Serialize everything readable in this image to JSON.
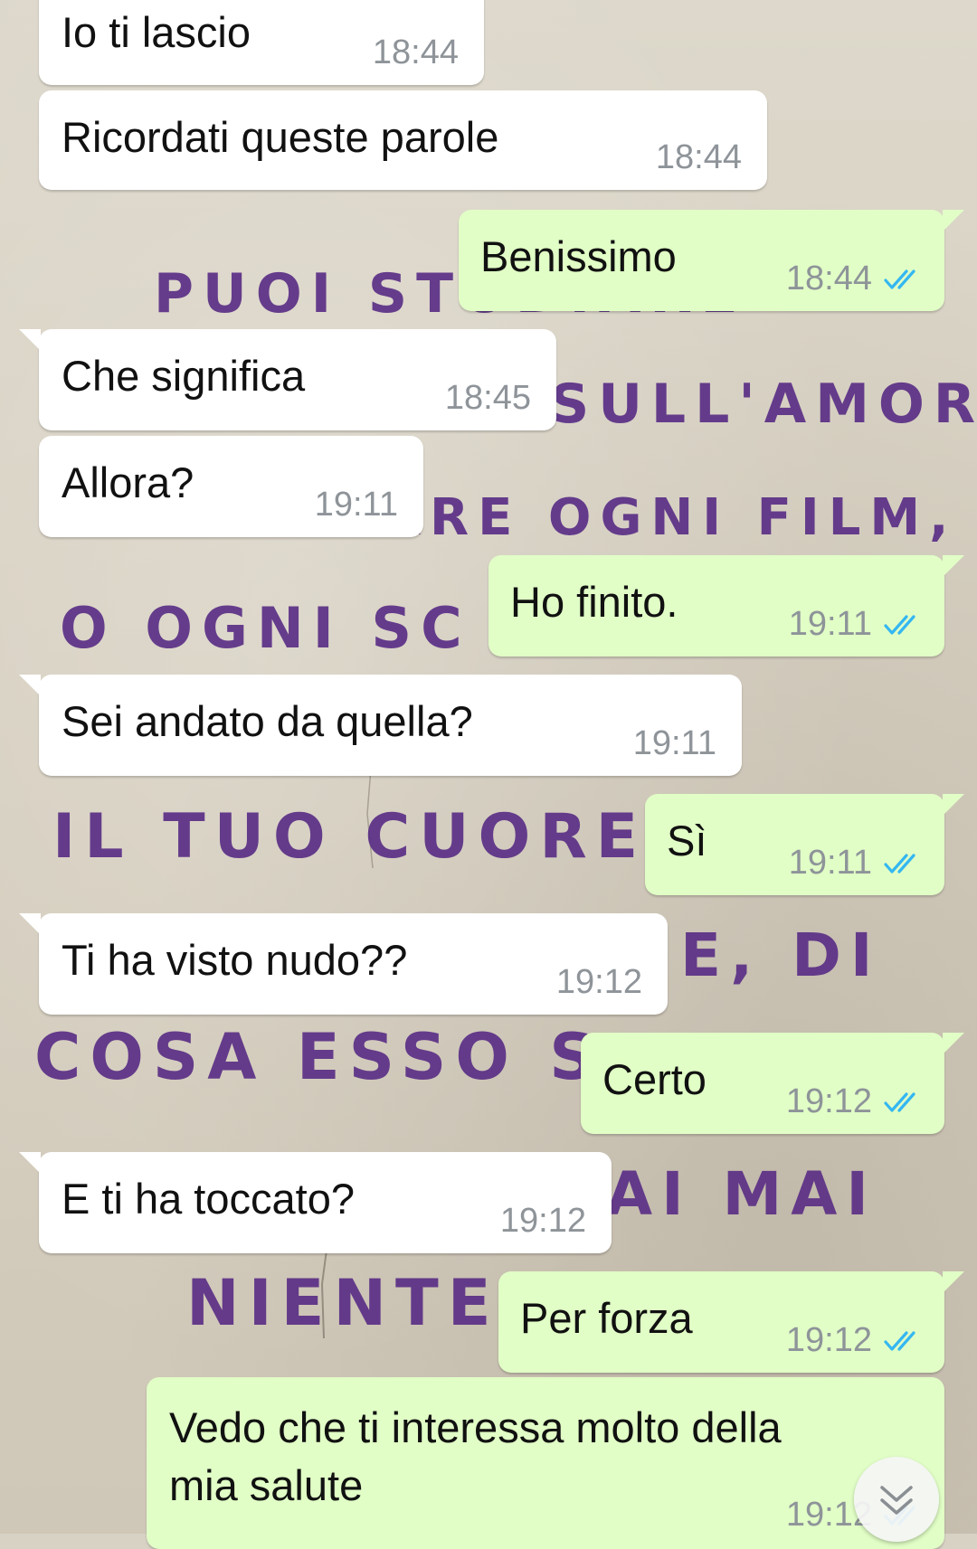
{
  "colors": {
    "incoming_bubble": "#ffffff",
    "outgoing_bubble": "#e1fec6",
    "read_ticks": "#34b7f1",
    "timestamp": "#8e9499",
    "graffiti": "#5b2f86"
  },
  "wallpaper": {
    "lines": [
      "PUOI STUDIARE",
      "SULL'AMORE",
      "CONSULTARE OGNI FILM,",
      "O OGNI SC",
      "IL TUO CUORE",
      "E, DI",
      "COSA ESSO S",
      "AI MAI",
      "NIENTE"
    ]
  },
  "messages": [
    {
      "direction": "incoming",
      "text": "Io ti lascio",
      "time": "18:44"
    },
    {
      "direction": "incoming",
      "text": "Ricordati queste parole",
      "time": "18:44"
    },
    {
      "direction": "outgoing",
      "text": "Benissimo",
      "time": "18:44",
      "status": "read"
    },
    {
      "direction": "incoming",
      "text": "Che significa",
      "time": "18:45"
    },
    {
      "direction": "incoming",
      "text": "Allora?",
      "time": "19:11"
    },
    {
      "direction": "outgoing",
      "text": "Ho finito.",
      "time": "19:11",
      "status": "read"
    },
    {
      "direction": "incoming",
      "text": "Sei andato da quella?",
      "time": "19:11"
    },
    {
      "direction": "outgoing",
      "text": "Sì",
      "time": "19:11",
      "status": "read"
    },
    {
      "direction": "incoming",
      "text": "Ti ha visto nudo??",
      "time": "19:12"
    },
    {
      "direction": "outgoing",
      "text": "Certo",
      "time": "19:12",
      "status": "read"
    },
    {
      "direction": "incoming",
      "text": "E ti ha toccato?",
      "time": "19:12"
    },
    {
      "direction": "outgoing",
      "text": "Per forza",
      "time": "19:12",
      "status": "read"
    },
    {
      "direction": "outgoing",
      "text_lines": [
        "Vedo che ti interessa molto della",
        "mia salute"
      ],
      "time": "19:12",
      "status": "read"
    }
  ],
  "scroll_to_bottom": {
    "icon": "double-chevron-down-icon"
  }
}
